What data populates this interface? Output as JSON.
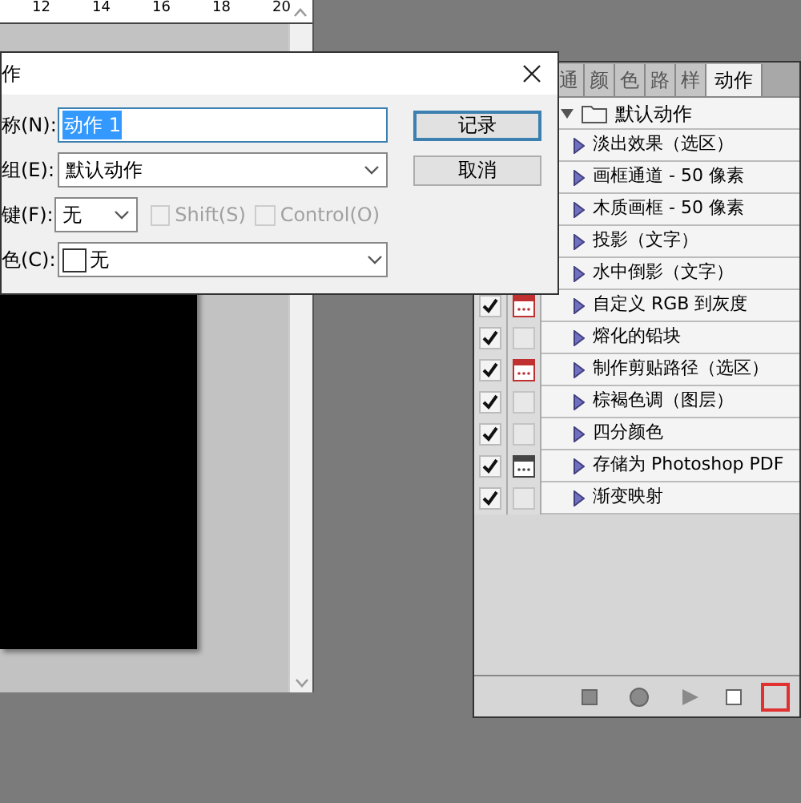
{
  "document": {
    "ruler_labels": [
      "12",
      "14",
      "16",
      "18",
      "20"
    ]
  },
  "dialog": {
    "title": "作",
    "buttons": [
      {
        "label": "记录",
        "default": true
      },
      {
        "label": "取消",
        "default": false
      }
    ],
    "fields": [
      {
        "kind": "text",
        "label": "称(N):",
        "value": "动作 1"
      },
      {
        "kind": "select",
        "label": "组(E):",
        "value": "默认动作"
      },
      {
        "kind": "key",
        "label": "键(F):",
        "value": "无",
        "options": [
          {
            "label": "Shift(S)",
            "checked": false,
            "disabled": true
          },
          {
            "label": "Control(O)",
            "checked": false,
            "disabled": true
          }
        ]
      },
      {
        "kind": "color",
        "label": "色(C):",
        "value": "无"
      }
    ]
  },
  "panel": {
    "tabs": [
      {
        "label": "通",
        "selected": false
      },
      {
        "label": "颜",
        "selected": false
      },
      {
        "label": "色",
        "selected": false
      },
      {
        "label": "路",
        "selected": false
      },
      {
        "label": "样",
        "selected": false
      },
      {
        "label": "动作",
        "selected": true
      }
    ],
    "set": {
      "name": "默认动作",
      "expanded": true
    },
    "actions": [
      {
        "name": "淡出效果（选区）"
      },
      {
        "name": "画框通道 - 50 像素"
      },
      {
        "name": "木质画框 - 50 像素"
      },
      {
        "name": "投影（文字）"
      },
      {
        "name": "水中倒影（文字）"
      },
      {
        "name": "自定义 RGB 到灰度",
        "checked": true,
        "dialog_on": true,
        "dialog_partial": true
      },
      {
        "name": "熔化的铅块",
        "checked": true,
        "dialog_on": false
      },
      {
        "name": "制作剪贴路径（选区）",
        "checked": true,
        "dialog_on": true,
        "dialog_partial": true
      },
      {
        "name": "棕褐色调（图层）",
        "checked": true,
        "dialog_on": false
      },
      {
        "name": "四分颜色",
        "checked": true,
        "dialog_on": false
      },
      {
        "name": "存储为 Photoshop PDF",
        "checked": true,
        "dialog_on": true,
        "dialog_partial": false
      },
      {
        "name": "渐变映射",
        "checked": true,
        "dialog_on": false
      }
    ],
    "new_action_highlighted": true
  }
}
